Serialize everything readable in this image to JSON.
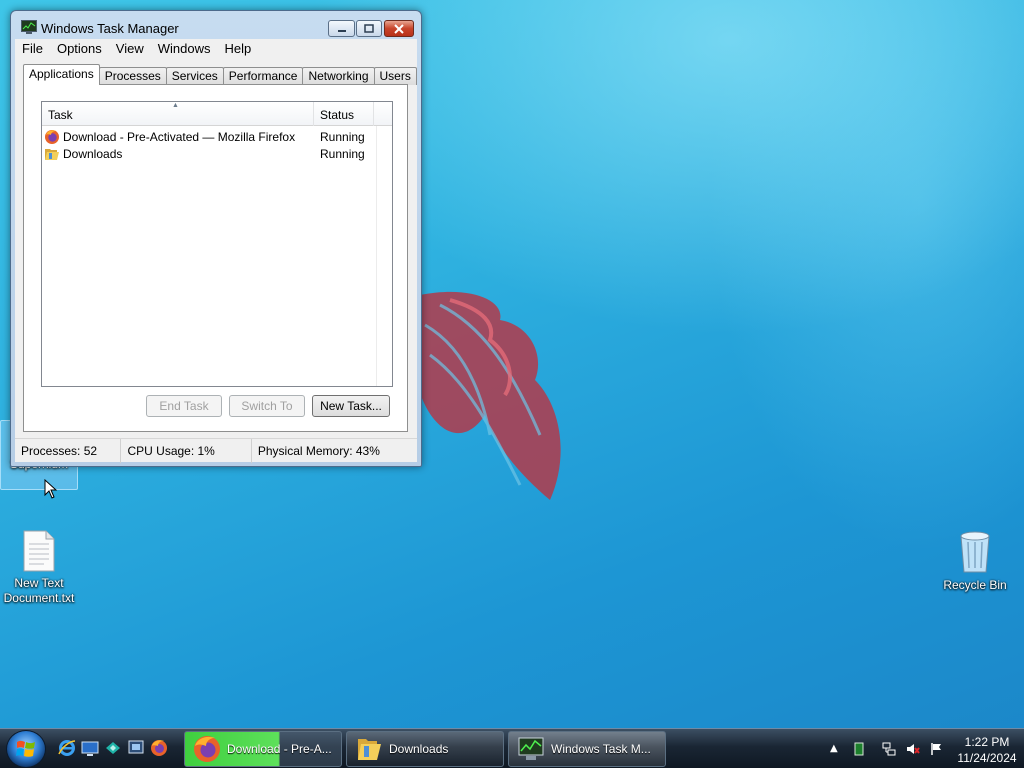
{
  "window": {
    "title": "Windows Task Manager",
    "menu": [
      "File",
      "Options",
      "View",
      "Windows",
      "Help"
    ],
    "tabs": [
      "Applications",
      "Processes",
      "Services",
      "Performance",
      "Networking",
      "Users"
    ],
    "active_tab": "Applications",
    "columns": {
      "task": "Task",
      "status": "Status"
    },
    "rows": [
      {
        "task": "Download - Pre-Activated — Mozilla Firefox",
        "status": "Running",
        "icon": "firefox-icon"
      },
      {
        "task": "Downloads",
        "status": "Running",
        "icon": "folder-icon"
      }
    ],
    "buttons": {
      "end_task": "End Task",
      "switch_to": "Switch To",
      "new_task": "New Task..."
    },
    "status_bar": {
      "processes": "Processes: 52",
      "cpu": "CPU Usage: 1%",
      "memory": "Physical Memory: 43%"
    }
  },
  "desktop": {
    "icons": [
      {
        "label": "Supernium",
        "name": "supernium"
      },
      {
        "label": "New Text Document.txt",
        "name": "new-text-document"
      },
      {
        "label": "Recycle Bin",
        "name": "recycle-bin"
      }
    ]
  },
  "taskbar": {
    "buttons": [
      {
        "label": "Download - Pre-A...",
        "icon": "firefox-icon",
        "progress": 0.6
      },
      {
        "label": "Downloads",
        "icon": "folder-icon"
      },
      {
        "label": "Windows Task M...",
        "icon": "task-manager-icon"
      }
    ],
    "clock": {
      "time": "1:22 PM",
      "date": "11/24/2024"
    }
  },
  "colors": {
    "accent": "#2fb2e0",
    "close_button": "#c8442a",
    "progress": "#3fcf3f"
  }
}
